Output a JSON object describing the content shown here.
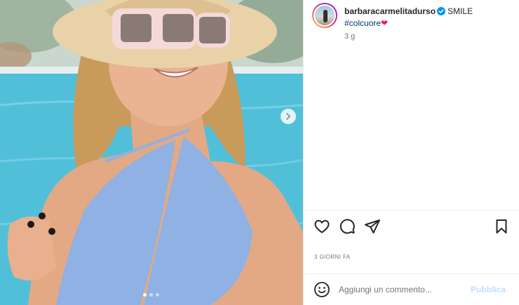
{
  "post": {
    "username": "barbaracarmelitadurso",
    "verified_icon": "verified-badge-icon",
    "caption": "SMILE",
    "hashtag": "#colcuore",
    "emoji": "❤",
    "time_ago": "3 g",
    "date_label": "3 GIORNI FA"
  },
  "carousel": {
    "slide_count": 3,
    "active_slide": 1,
    "next_icon": "chevron-right-icon"
  },
  "actions": {
    "like_icon": "heart-icon",
    "comment_icon": "comment-icon",
    "share_icon": "paper-plane-icon",
    "save_icon": "bookmark-icon"
  },
  "comment": {
    "placeholder": "Aggiungi un commento...",
    "publish_label": "Pubblica",
    "emoji_icon": "smiley-icon"
  },
  "colors": {
    "accent_blue": "#0095f6",
    "publish_disabled": "#c0dffd",
    "hashtag": "#00376b",
    "verified": "#0095f6",
    "text": "#262626",
    "secondary_text": "#737373"
  }
}
